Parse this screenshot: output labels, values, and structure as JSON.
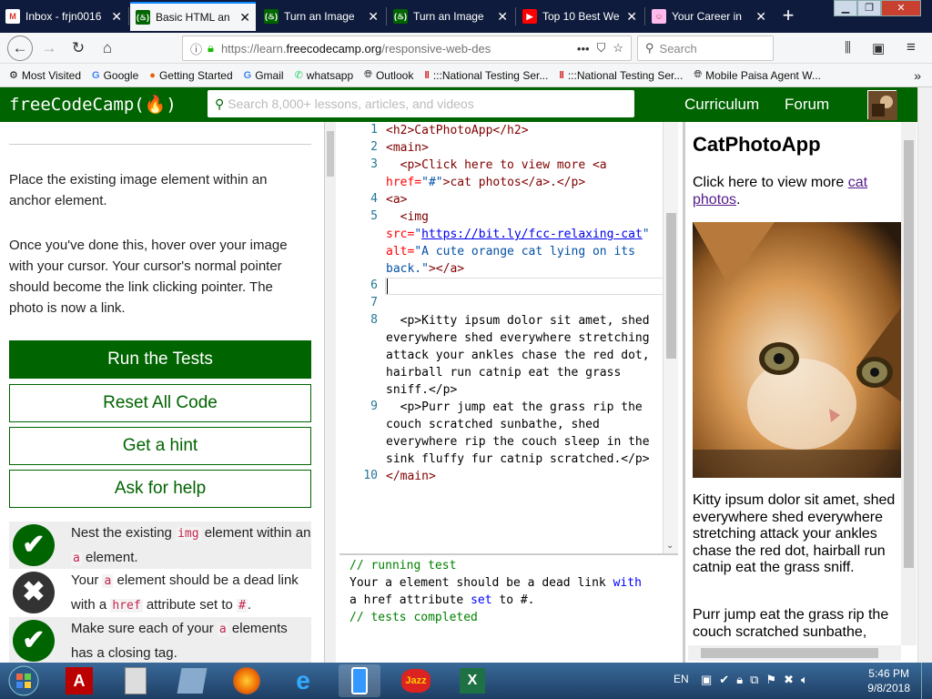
{
  "browser": {
    "tabs": [
      {
        "title": "Inbox - frjn0016",
        "icon": "gmail-icon",
        "color": "#d93025",
        "active": false
      },
      {
        "title": "Basic HTML an",
        "icon": "freecodecamp-icon",
        "color": "#006400",
        "active": true
      },
      {
        "title": "Turn an Image",
        "icon": "freecodecamp-icon",
        "color": "#006400",
        "active": false
      },
      {
        "title": "Turn an Image",
        "icon": "freecodecamp-icon",
        "color": "#006400",
        "active": false
      },
      {
        "title": "Top 10 Best We",
        "icon": "youtube-icon",
        "color": "#ff0000",
        "active": false
      },
      {
        "title": "Your Career in",
        "icon": "career-icon",
        "color": "#c99",
        "active": false
      }
    ],
    "url_prefix": "https://learn.",
    "url_domain": "freecodecamp.org",
    "url_rest": "/responsive-web-des",
    "search_placeholder": "Search",
    "bookmarks": [
      {
        "label": "Most Visited",
        "icon": "gear-icon"
      },
      {
        "label": "Google",
        "icon": "google-icon"
      },
      {
        "label": "Getting Started",
        "icon": "firefox-icon"
      },
      {
        "label": "Gmail",
        "icon": "google-icon"
      },
      {
        "label": "whatsapp",
        "icon": "whatsapp-icon"
      },
      {
        "label": "Outlook",
        "icon": "globe-icon"
      },
      {
        "label": ":::National Testing Ser...",
        "icon": "bars-icon"
      },
      {
        "label": ":::National Testing Ser...",
        "icon": "bars-icon"
      },
      {
        "label": "Mobile Paisa Agent W...",
        "icon": "globe-icon"
      }
    ]
  },
  "fcc": {
    "logo": "freeCodeCamp(🔥)",
    "search_placeholder": "Search 8,000+ lessons, articles, and videos",
    "nav": [
      "Curriculum",
      "Forum"
    ],
    "brand_color": "#006400"
  },
  "lesson": {
    "desc1": "Place the existing image element within an anchor element.",
    "desc2": "Once you've done this, hover over your image with your cursor. Your cursor's normal pointer should become the link clicking pointer. The photo is now a link.",
    "buttons": [
      "Run the Tests",
      "Reset All Code",
      "Get a hint",
      "Ask for help"
    ],
    "tests": [
      {
        "status": "pass",
        "pre": "Nest the existing ",
        "code1": "img",
        "mid": " element within an ",
        "code2": "a",
        "post": " element."
      },
      {
        "status": "fail",
        "pre": "Your ",
        "code1": "a",
        "mid": " element should be a dead link with a ",
        "code2": "href",
        "mid2": " attribute set to ",
        "code3": "#",
        "post": "."
      },
      {
        "status": "pass",
        "pre": "Make sure each of your ",
        "code1": "a",
        "post": " elements has a closing tag."
      }
    ]
  },
  "editor": {
    "line_numbers": [
      "1",
      "2",
      "3",
      "4",
      "5",
      "6",
      "7",
      "8",
      "9",
      "10"
    ],
    "l1": "<h2>CatPhotoApp</h2>",
    "l2": "<main>",
    "l3a": "  <p>Click here to view more <a",
    "l3b_attr": "href=",
    "l3b_str": "\"#\"",
    "l3b_rest": ">cat photos</a>.</p>",
    "l4": "<a>",
    "l5a": "  <img",
    "l5b_attr": "src=",
    "l5b_url": "https://bit.ly/fcc-relaxing-cat",
    "l5c_attr": "alt=",
    "l5c_str": "\"A cute orange cat lying on its back.\"",
    "l5c_rest": "></a>",
    "l8": "  <p>Kitty ipsum dolor sit amet, shed everywhere shed everywhere stretching attack your ankles chase the red dot, hairball run catnip eat the grass sniff.</p>",
    "l9": "  <p>Purr jump eat the grass rip the couch scratched sunbathe, shed everywhere rip the couch sleep in the sink fluffy fur catnip scratched.</p>",
    "l10": "</main>"
  },
  "console": {
    "line1": "// running test",
    "line2a": "Your a element should be a dead link ",
    "line2kw": "with",
    "line3a": "a href attribute ",
    "line3kw": "set",
    "line3b": " to #.",
    "line4": "// tests completed"
  },
  "preview": {
    "title": "CatPhotoApp",
    "p1_text": "Click here to view more ",
    "p1_link": "cat photos",
    "p1_end": ".",
    "p2": "Kitty ipsum dolor sit amet, shed everywhere shed everywhere stretching attack your ankles chase the red dot, hairball run catnip eat the grass sniff.",
    "p3": "Purr jump eat the grass rip the couch scratched sunbathe,"
  },
  "taskbar": {
    "lang": "EN",
    "time": "5:46 PM",
    "date": "9/8/2018",
    "apps": [
      "windows-start-icon",
      "acrobat-icon",
      "calculator-icon",
      "notepad-icon",
      "firefox-icon",
      "internet-explorer-icon",
      "phone-icon",
      "jazz-icon",
      "excel-icon"
    ]
  }
}
